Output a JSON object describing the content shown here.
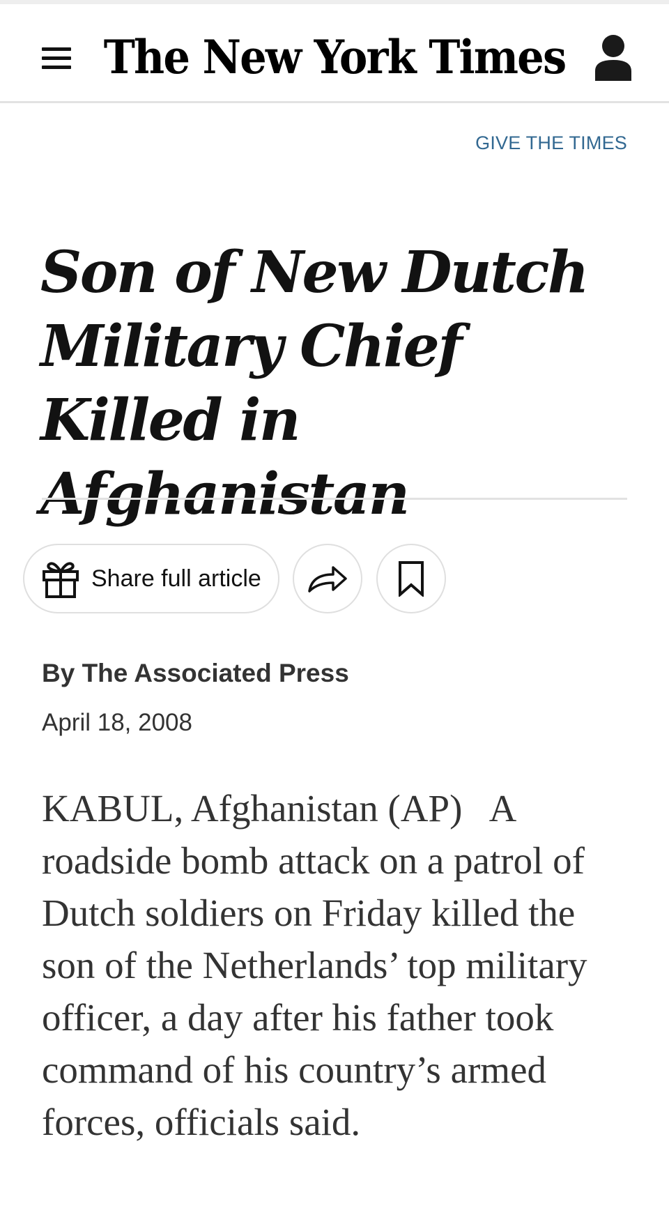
{
  "header": {
    "menu_icon": "hamburger-menu-icon",
    "masthead": "The New York Times",
    "account_icon": "person-icon"
  },
  "give_link": "GIVE THE TIMES",
  "article": {
    "headline": "Son of New Dutch Military Chief Killed in Afghanistan",
    "byline": "By The Associated Press",
    "date": "April 18, 2008",
    "body": "KABUL, Afghanistan (AP)   A roadside bomb attack on a patrol of Dutch soldiers on Friday killed the son of the Netherlands’ top military officer, a day after his father took command of his country’s armed forces, officials said."
  },
  "actions": {
    "share_label": "Share full article",
    "gift_icon": "gift-icon",
    "forward_icon": "share-arrow-icon",
    "bookmark_icon": "bookmark-icon"
  },
  "colors": {
    "link_blue": "#326891",
    "text": "#121212",
    "secondary_text": "#333333",
    "border": "#dfdfdf"
  }
}
